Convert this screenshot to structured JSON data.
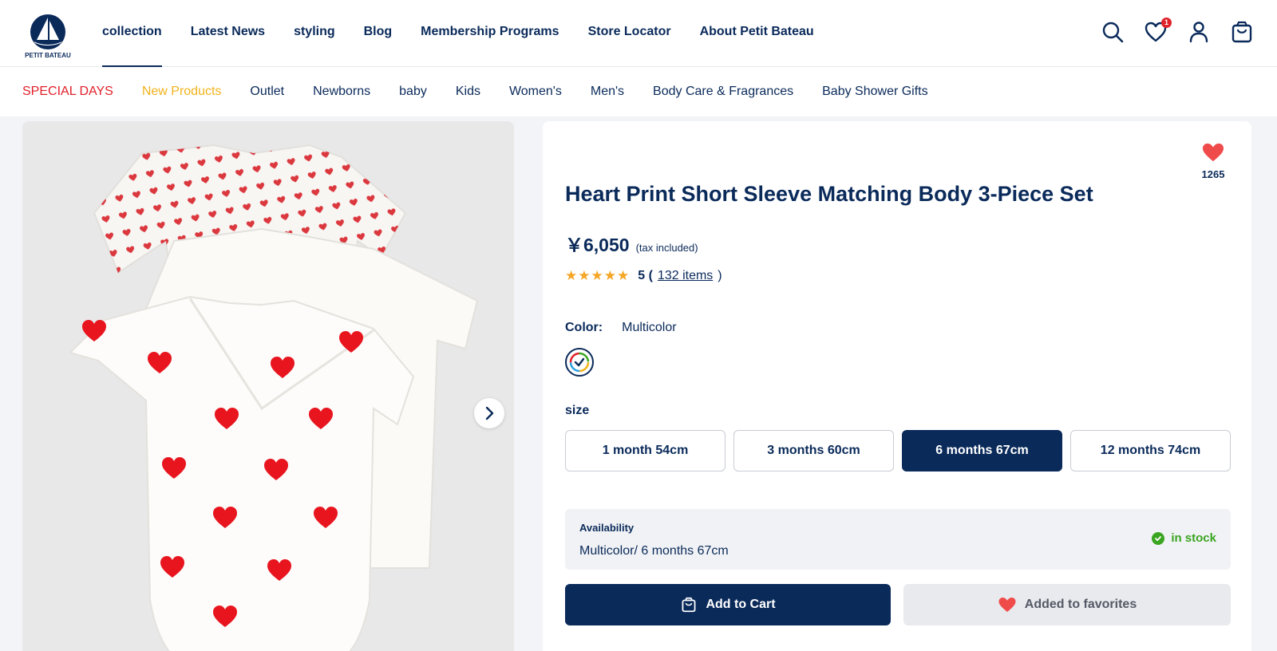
{
  "brand": {
    "name": "PETIT BATEAU"
  },
  "main_nav": [
    {
      "label": "collection",
      "active": true
    },
    {
      "label": "Latest News"
    },
    {
      "label": "styling"
    },
    {
      "label": "Blog"
    },
    {
      "label": "Membership Programs"
    },
    {
      "label": "Store Locator"
    },
    {
      "label": "About Petit Bateau"
    }
  ],
  "header_icons": {
    "search": "search-icon",
    "favorites": "heart-icon",
    "favorites_badge": "1",
    "account": "user-icon",
    "cart": "shopping-bag-icon"
  },
  "sub_nav": [
    {
      "label": "SPECIAL DAYS",
      "color": "#e0202a"
    },
    {
      "label": "New Products",
      "color": "#f2b21c"
    },
    {
      "label": "Outlet"
    },
    {
      "label": "Newborns"
    },
    {
      "label": "baby"
    },
    {
      "label": "Kids"
    },
    {
      "label": "Women's"
    },
    {
      "label": "Men's"
    },
    {
      "label": "Body Care & Fragrances"
    },
    {
      "label": "Baby Shower Gifts"
    }
  ],
  "product": {
    "title": "Heart Print Short Sleeve Matching Body 3-Piece Set",
    "price": "￥6,050",
    "tax_note": "(tax included)",
    "rating": {
      "stars": 5,
      "score": "5 (",
      "reviews": "132 items",
      "close": ")"
    },
    "favorites_count": "1265",
    "color_label": "Color:",
    "color_value": "Multicolor",
    "size_label": "size",
    "sizes": [
      {
        "label": "1 month 54cm"
      },
      {
        "label": "3 months 60cm"
      },
      {
        "label": "6 months 67cm",
        "selected": true
      },
      {
        "label": "12 months 74cm"
      }
    ],
    "availability_label": "Availability",
    "availability_value": "Multicolor/ 6 months 67cm",
    "stock_status": "in stock",
    "add_to_cart": "Add to Cart",
    "added_to_favorites": "Added to favorites"
  },
  "colors": {
    "navy": "#0a2a5a",
    "red": "#e0202a",
    "accent_yellow": "#f2b21c",
    "stock_green": "#3aa520",
    "heart": "#f04b4b",
    "star": "#f5a623"
  }
}
